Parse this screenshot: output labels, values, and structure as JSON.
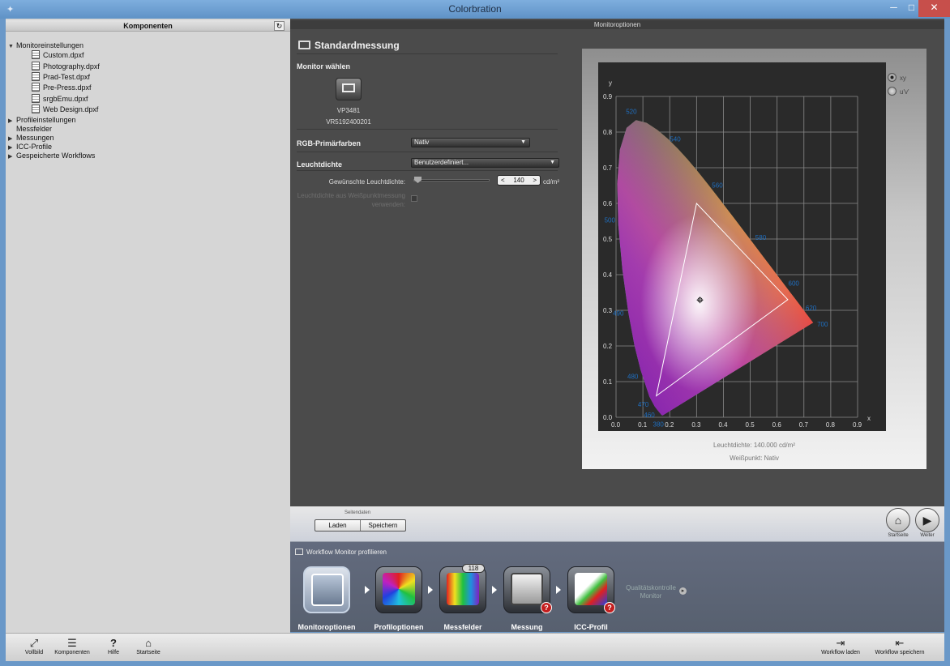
{
  "window": {
    "title": "Colorbration"
  },
  "left_panel": {
    "title": "Komponenten",
    "tree": [
      {
        "label": "Monitoreinstellungen",
        "expanded": true,
        "children": [
          "Custom.dpxf",
          "Photography.dpxf",
          "Prad-Test.dpxf",
          "Pre-Press.dpxf",
          "srgbEmu.dpxf",
          "Web Design.dpxf"
        ]
      },
      {
        "label": "Profileinstellungen",
        "expanded": false
      },
      {
        "label": "Messfelder"
      },
      {
        "label": "Messungen",
        "expanded": false
      },
      {
        "label": "ICC-Profile",
        "expanded": false
      },
      {
        "label": "Gespeicherte Workflows",
        "expanded": false
      }
    ]
  },
  "main": {
    "header": "Monitoroptionen",
    "section_title": "Standardmessung",
    "monitor_label": "Monitor wählen",
    "monitor_name": "VP3481",
    "monitor_serial": "VR5192400201",
    "rgb_label": "RGB-Primärfarben",
    "rgb_value": "Nativ",
    "luminance_label": "Leuchtdichte",
    "luminance_value": "Benutzerdefiniert...",
    "desired_luminance_label": "Gewünschte Leuchtdichte:",
    "desired_luminance_value": "140",
    "unit": "cd/m²",
    "use_whitepoint_label_1": "Leuchtdichte aus Weißpunktmessung",
    "use_whitepoint_label_2": "verwenden:",
    "radio_xy": "xy",
    "radio_uv": "u'v'",
    "chart_info_luminance": "Leuchtdichte: 140.000 cd/m²",
    "chart_info_whitepoint": "Weißpunkt: Nativ"
  },
  "chart_data": {
    "type": "scatter",
    "xlabel": "x",
    "ylabel": "y",
    "xlim": [
      0,
      0.9
    ],
    "ylim": [
      0,
      0.9
    ],
    "grid": true,
    "x_ticks": [
      "0.0",
      "0.1",
      "0.2",
      "0.3",
      "0.4",
      "0.5",
      "0.6",
      "0.7",
      "0.8",
      "0.9"
    ],
    "y_ticks": [
      "0.0",
      "0.1",
      "0.2",
      "0.3",
      "0.4",
      "0.5",
      "0.6",
      "0.7",
      "0.8",
      "0.9"
    ],
    "spectral_locus": [
      [
        0.1741,
        0.005
      ],
      [
        0.1714,
        0.0051
      ],
      [
        0.1689,
        0.0069
      ],
      [
        0.1644,
        0.0109
      ],
      [
        0.1566,
        0.0177
      ],
      [
        0.144,
        0.0297
      ],
      [
        0.1241,
        0.0578
      ],
      [
        0.0913,
        0.1327
      ],
      [
        0.0687,
        0.2007
      ],
      [
        0.0454,
        0.295
      ],
      [
        0.0235,
        0.4127
      ],
      [
        0.0082,
        0.5384
      ],
      [
        0.0039,
        0.6548
      ],
      [
        0.0139,
        0.7502
      ],
      [
        0.0389,
        0.812
      ],
      [
        0.0743,
        0.8338
      ],
      [
        0.1142,
        0.8262
      ],
      [
        0.1547,
        0.8059
      ],
      [
        0.1929,
        0.7816
      ],
      [
        0.2296,
        0.7543
      ],
      [
        0.2658,
        0.7243
      ],
      [
        0.3016,
        0.6923
      ],
      [
        0.3373,
        0.6589
      ],
      [
        0.3731,
        0.6245
      ],
      [
        0.4087,
        0.5896
      ],
      [
        0.4441,
        0.5547
      ],
      [
        0.4788,
        0.5202
      ],
      [
        0.5125,
        0.4866
      ],
      [
        0.5448,
        0.4544
      ],
      [
        0.5752,
        0.4242
      ],
      [
        0.6029,
        0.3965
      ],
      [
        0.627,
        0.3725
      ],
      [
        0.6482,
        0.3514
      ],
      [
        0.6658,
        0.334
      ],
      [
        0.6915,
        0.3083
      ],
      [
        0.7079,
        0.292
      ],
      [
        0.7347,
        0.2653
      ]
    ],
    "wavelength_labels": [
      {
        "label": "380",
        "x": 0.1741,
        "y": 0.005
      },
      {
        "label": "460",
        "x": 0.144,
        "y": 0.0297
      },
      {
        "label": "470",
        "x": 0.1241,
        "y": 0.0578
      },
      {
        "label": "480",
        "x": 0.0913,
        "y": 0.1327
      },
      {
        "label": "490",
        "x": 0.0454,
        "y": 0.295
      },
      {
        "label": "500",
        "x": 0.0082,
        "y": 0.5384
      },
      {
        "label": "520",
        "x": 0.0743,
        "y": 0.8338
      },
      {
        "label": "540",
        "x": 0.2296,
        "y": 0.7543
      },
      {
        "label": "560",
        "x": 0.3731,
        "y": 0.6245
      },
      {
        "label": "580",
        "x": 0.5125,
        "y": 0.4866
      },
      {
        "label": "600",
        "x": 0.627,
        "y": 0.3725
      },
      {
        "label": "620",
        "x": 0.6915,
        "y": 0.3083
      },
      {
        "label": "700",
        "x": 0.7347,
        "y": 0.2653
      }
    ],
    "gamut_triangle": [
      [
        0.64,
        0.33
      ],
      [
        0.3,
        0.6
      ],
      [
        0.15,
        0.06
      ]
    ],
    "whitepoint": [
      0.3127,
      0.329
    ]
  },
  "page_footer": {
    "section_label": "Seitendaten",
    "load": "Laden",
    "save": "Speichern",
    "home_label": "Startseite",
    "next_label": "Weiter"
  },
  "workflow": {
    "title": "Workflow Monitor profilieren",
    "steps": [
      "Monitoroptionen",
      "Profiloptionen",
      "Messfelder",
      "Messung",
      "ICC-Profil"
    ],
    "messfelder_count": "118",
    "quality_1": "Qualitätskontrolle",
    "quality_2": "Monitor"
  },
  "toolbar": {
    "fullscreen": "Vollbild",
    "components": "Komponenten",
    "help": "Hilfe",
    "home": "Startseite",
    "load_workflow": "Workflow laden",
    "save_workflow": "Workflow speichern"
  },
  "colors": {
    "window_blue": "#6a98c8",
    "close_red": "#c74f4b",
    "dark_panel": "#4b4b4b",
    "wavelength_blue": "#1f6fc0"
  }
}
